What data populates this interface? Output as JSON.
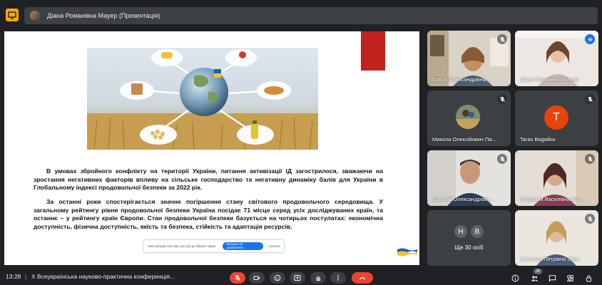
{
  "presentation": {
    "label": "Діана Романівна Мауер (Презентація)"
  },
  "slide": {
    "paragraph1": "В умовах збройного конфлікту на території України, питання активізації ІД загострилося, зважаючи на зростання негативних факторів впливу на сільське господарство та негативну динаміку балів для України в Глобальному індексі продовольчої безпеки за 2022 рік.",
    "paragraph2": "За останні роки спостерігається значне погіршення стану світового продовольчого середовища. У загальному рейтингу рівня продовольчої безпеки Україна посідає 71 місце серед усіх досліджуваних країн, та останнє – у рейтингу країн Європи. Стан продовольчої безпеки базується на чотирьох постулатах: економічна доступність, фізична доступність, якість та безпека, стійкість та адаптація ресурсів.",
    "translate_text": "meet.google.com має доступ до вашого екрана",
    "translate_button": "Більше не дозволяти",
    "translate_close": "Сховати"
  },
  "participants": [
    {
      "name": "Ольга Олександрівна ...",
      "mic": "off"
    },
    {
      "name": "Діана Романівна Мауер",
      "mic": "on"
    },
    {
      "name": "Микола Олексійович Па...",
      "mic": "off"
    },
    {
      "name": "Taras Bagalika",
      "mic": "off",
      "initial": "T",
      "avatar_color": "#e8430a"
    },
    {
      "name": "Олексій Олександрови...",
      "mic": "off"
    },
    {
      "name": "Людмила Василівна Жи...",
      "mic": "off"
    },
    {
      "name": "Світлана Петрівна Зоря",
      "mic": "off"
    }
  ],
  "more": {
    "initials": [
      "Н",
      "В"
    ],
    "label": "Ще 30 осіб"
  },
  "bottom": {
    "time": "13:28",
    "separator": "|",
    "meeting_title": "X Всеукраїнська науково-практична конференція...",
    "participant_count": "38"
  },
  "colors": {
    "accent": "#1a73e8",
    "danger": "#ea4335",
    "tile": "#3c4043",
    "background": "#202124"
  }
}
